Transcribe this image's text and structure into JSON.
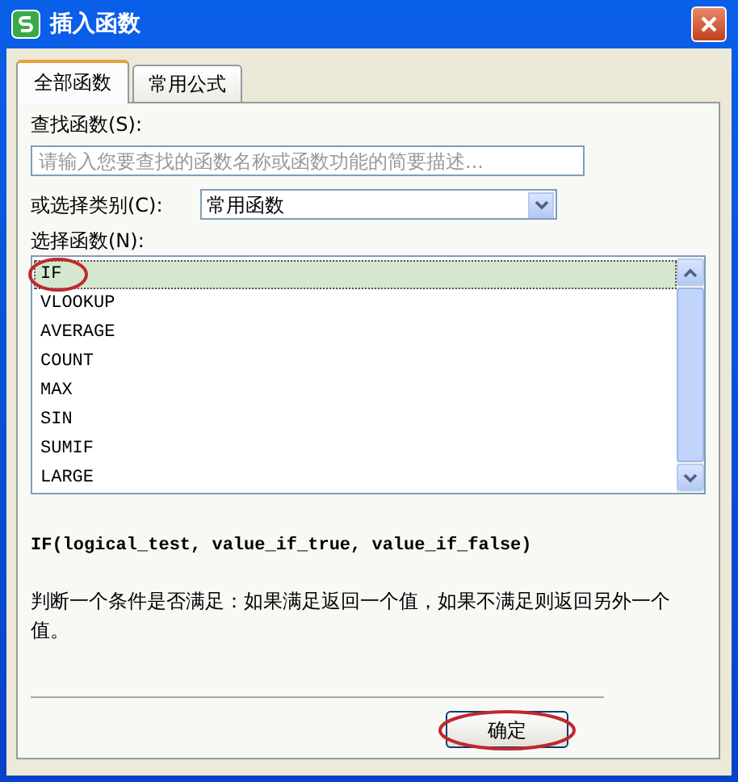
{
  "window": {
    "title": "插入函数"
  },
  "tabs": [
    {
      "label": "全部函数",
      "selected": true
    },
    {
      "label": "常用公式",
      "selected": false
    }
  ],
  "search": {
    "label": "查找函数(S):",
    "placeholder": "请输入您要查找的函数名称或函数功能的简要描述..."
  },
  "category": {
    "label": "或选择类别(C):",
    "value": "常用函数"
  },
  "function_list": {
    "label": "选择函数(N):",
    "items": [
      {
        "name": "IF",
        "selected": true,
        "circled": true
      },
      {
        "name": "VLOOKUP",
        "selected": false,
        "circled": false
      },
      {
        "name": "AVERAGE",
        "selected": false,
        "circled": false
      },
      {
        "name": "COUNT",
        "selected": false,
        "circled": false
      },
      {
        "name": "MAX",
        "selected": false,
        "circled": false
      },
      {
        "name": "SIN",
        "selected": false,
        "circled": false
      },
      {
        "name": "SUMIF",
        "selected": false,
        "circled": false
      },
      {
        "name": "LARGE",
        "selected": false,
        "circled": false
      }
    ]
  },
  "signature": "IF(logical_test, value_if_true, value_if_false)",
  "description": "判断一个条件是否满足：如果满足返回一个值，如果不满足则返回另外一个值。",
  "buttons": [
    {
      "label": "确定",
      "circled": true
    }
  ]
}
